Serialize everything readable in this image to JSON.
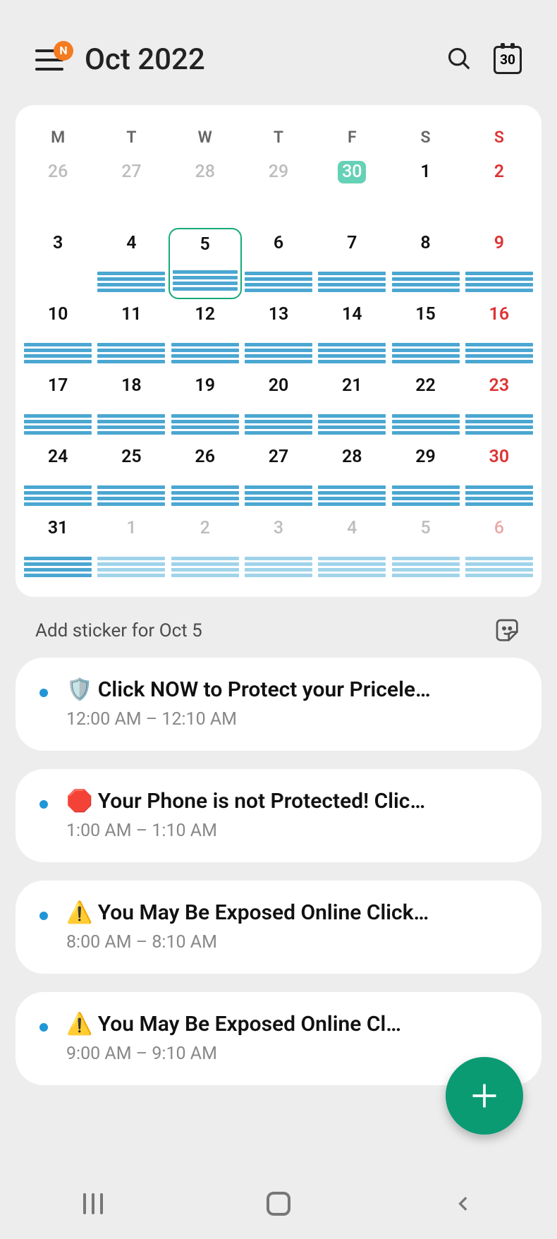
{
  "header": {
    "badge": "N",
    "title": "Oct  2022",
    "today_num": "30"
  },
  "dow": [
    "M",
    "T",
    "W",
    "T",
    "F",
    "S",
    "S"
  ],
  "weeks": [
    [
      {
        "n": "26",
        "cls": "prev",
        "bars": 0
      },
      {
        "n": "27",
        "cls": "prev",
        "bars": 0
      },
      {
        "n": "28",
        "cls": "prev",
        "bars": 0
      },
      {
        "n": "29",
        "cls": "prev",
        "bars": 0
      },
      {
        "n": "30",
        "cls": "prev today",
        "bars": 0
      },
      {
        "n": "1",
        "cls": "",
        "bars": 0
      },
      {
        "n": "2",
        "cls": "sun",
        "bars": 0
      }
    ],
    [
      {
        "n": "3",
        "cls": "",
        "bars": 0
      },
      {
        "n": "4",
        "cls": "",
        "bars": 4
      },
      {
        "n": "5",
        "cls": "selected",
        "bars": 4
      },
      {
        "n": "6",
        "cls": "",
        "bars": 4
      },
      {
        "n": "7",
        "cls": "",
        "bars": 4
      },
      {
        "n": "8",
        "cls": "",
        "bars": 4
      },
      {
        "n": "9",
        "cls": "sun",
        "bars": 4
      }
    ],
    [
      {
        "n": "10",
        "cls": "",
        "bars": 4
      },
      {
        "n": "11",
        "cls": "",
        "bars": 4
      },
      {
        "n": "12",
        "cls": "",
        "bars": 4
      },
      {
        "n": "13",
        "cls": "",
        "bars": 4
      },
      {
        "n": "14",
        "cls": "",
        "bars": 4
      },
      {
        "n": "15",
        "cls": "",
        "bars": 4
      },
      {
        "n": "16",
        "cls": "sun",
        "bars": 4
      }
    ],
    [
      {
        "n": "17",
        "cls": "",
        "bars": 4
      },
      {
        "n": "18",
        "cls": "",
        "bars": 4
      },
      {
        "n": "19",
        "cls": "",
        "bars": 4
      },
      {
        "n": "20",
        "cls": "",
        "bars": 4
      },
      {
        "n": "21",
        "cls": "",
        "bars": 4
      },
      {
        "n": "22",
        "cls": "",
        "bars": 4
      },
      {
        "n": "23",
        "cls": "sun",
        "bars": 4
      }
    ],
    [
      {
        "n": "24",
        "cls": "",
        "bars": 4
      },
      {
        "n": "25",
        "cls": "",
        "bars": 4
      },
      {
        "n": "26",
        "cls": "",
        "bars": 4
      },
      {
        "n": "27",
        "cls": "",
        "bars": 4
      },
      {
        "n": "28",
        "cls": "",
        "bars": 4
      },
      {
        "n": "29",
        "cls": "",
        "bars": 4
      },
      {
        "n": "30",
        "cls": "sun",
        "bars": 4
      }
    ],
    [
      {
        "n": "31",
        "cls": "",
        "bars": 4
      },
      {
        "n": "1",
        "cls": "next",
        "bars": 4,
        "faded": true
      },
      {
        "n": "2",
        "cls": "next",
        "bars": 4,
        "faded": true
      },
      {
        "n": "3",
        "cls": "next",
        "bars": 4,
        "faded": true
      },
      {
        "n": "4",
        "cls": "next",
        "bars": 4,
        "faded": true
      },
      {
        "n": "5",
        "cls": "next",
        "bars": 4,
        "faded": true
      },
      {
        "n": "6",
        "cls": "next sun",
        "bars": 4,
        "faded": true
      }
    ]
  ],
  "sticker_label": "Add sticker for Oct 5",
  "events": [
    {
      "icon": "🛡️",
      "title": "Click NOW to Protect your Pricele…",
      "time": "12:00 AM – 12:10 AM"
    },
    {
      "icon": "🛑",
      "title": "Your Phone is not Protected! Clic…",
      "time": "1:00 AM – 1:10 AM"
    },
    {
      "icon": "⚠️",
      "title": "You May Be Exposed Online  Click…",
      "time": "8:00 AM – 8:10 AM"
    },
    {
      "icon": "⚠️",
      "title": "You May Be Exposed Online  Cl…",
      "time": "9:00 AM – 9:10 AM"
    }
  ]
}
